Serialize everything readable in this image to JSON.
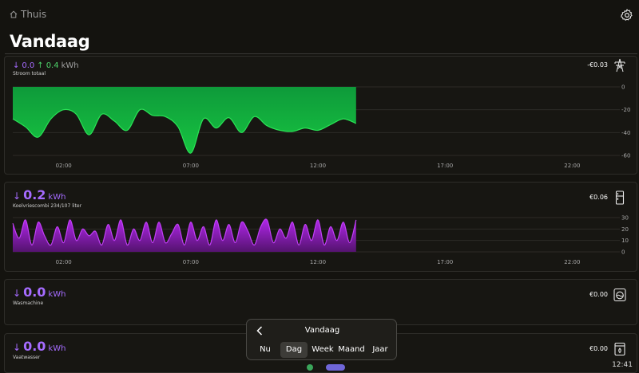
{
  "header": {
    "breadcrumb": "Thuis",
    "title": "Vandaag"
  },
  "cards": [
    {
      "id": "stroom",
      "consumed": "0.0",
      "produced": "0.4",
      "unit": "kWh",
      "label": "Stroom totaal",
      "cost": "-€0.03",
      "icon": "power-pylon-icon"
    },
    {
      "id": "koelvries",
      "consumed": "0.2",
      "unit": "kWh",
      "label": "Koelvriescombi 234/107 liter",
      "cost": "€0.06",
      "icon": "fridge-icon"
    },
    {
      "id": "wasmachine",
      "consumed": "0.0",
      "unit": "kWh",
      "label": "Wasmachine",
      "cost": "€0.00",
      "icon": "washing-machine-icon"
    },
    {
      "id": "vaatwasser",
      "consumed": "0.0",
      "unit": "kWh",
      "label": "Vaatwasser",
      "cost": "€0.00",
      "icon": "dishwasher-icon"
    }
  ],
  "period_selector": {
    "title": "Vandaag",
    "tabs": [
      "Nu",
      "Dag",
      "Week",
      "Maand",
      "Jaar"
    ],
    "active": "Dag"
  },
  "status_bar": {
    "time": "12:41"
  },
  "colors": {
    "background": "#14130f",
    "consumption_purple": "#a56bff",
    "production_green": "#4ed36a",
    "area_green": "#1fd847",
    "area_purple": "#b120e8"
  },
  "chart_data": [
    {
      "type": "area",
      "title": "",
      "series": [
        {
          "name": "",
          "color": "#1fd847"
        }
      ],
      "x_ticks": [
        "02:00",
        "07:00",
        "12:00",
        "17:00",
        "22:00"
      ],
      "y_ticks": [
        0,
        -20,
        -40,
        -60
      ],
      "ylim": [
        -60,
        0
      ],
      "x_range_hours": [
        0,
        24
      ],
      "grid": true,
      "x_hours": [
        0,
        0.5,
        1,
        1.5,
        2,
        2.5,
        3,
        3.5,
        4,
        4.5,
        5,
        5.5,
        6,
        6.5,
        7,
        7.5,
        8,
        8.5,
        9,
        9.5,
        10,
        10.5,
        11,
        11.5,
        12,
        12.5,
        13,
        13.5
      ],
      "values": [
        -28,
        -35,
        -44,
        -28,
        -20,
        -24,
        -42,
        -24,
        -30,
        -38,
        -20,
        -25,
        -26,
        -35,
        -58,
        -28,
        -36,
        -27,
        -40,
        -26,
        -34,
        -38,
        -39,
        -36,
        -38,
        -33,
        -28,
        -32
      ]
    },
    {
      "type": "area",
      "title": "",
      "series": [
        {
          "name": "",
          "color": "#b120e8"
        }
      ],
      "x_ticks": [
        "02:00",
        "07:00",
        "12:00",
        "17:00",
        "22:00"
      ],
      "y_ticks": [
        30,
        20,
        10,
        0
      ],
      "ylim": [
        0,
        30
      ],
      "x_range_hours": [
        0,
        24
      ],
      "grid": true,
      "x_hours": [
        0,
        0.25,
        0.5,
        0.75,
        1,
        1.25,
        1.5,
        1.75,
        2,
        2.25,
        2.5,
        2.75,
        3,
        3.25,
        3.5,
        3.75,
        4,
        4.25,
        4.5,
        4.75,
        5,
        5.25,
        5.5,
        5.75,
        6,
        6.25,
        6.5,
        6.75,
        7,
        7.25,
        7.5,
        7.75,
        8,
        8.25,
        8.5,
        8.75,
        9,
        9.25,
        9.5,
        9.75,
        10,
        10.25,
        10.5,
        10.75,
        11,
        11.25,
        11.5,
        11.75,
        12,
        12.25,
        12.5,
        12.75,
        13,
        13.25,
        13.5
      ],
      "values": [
        25,
        12,
        28,
        6,
        26,
        14,
        6,
        22,
        8,
        28,
        10,
        20,
        14,
        18,
        6,
        24,
        10,
        28,
        6,
        20,
        10,
        26,
        8,
        26,
        8,
        16,
        24,
        6,
        26,
        10,
        22,
        6,
        28,
        10,
        24,
        8,
        26,
        18,
        6,
        22,
        28,
        8,
        20,
        12,
        26,
        6,
        24,
        10,
        28,
        6,
        22,
        10,
        26,
        8,
        28
      ]
    }
  ]
}
